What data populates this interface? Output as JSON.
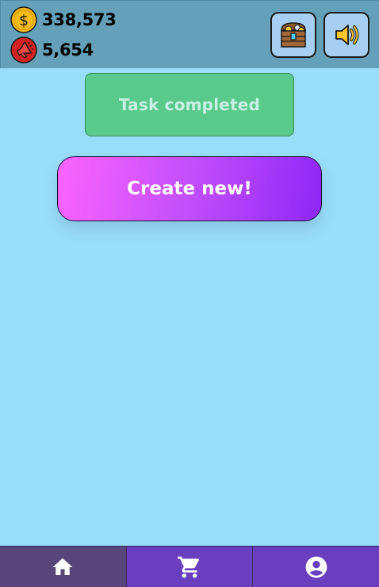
{
  "header": {
    "coins": {
      "value": "338,573",
      "icon": "dollar-coin-icon",
      "color": "#f5bc19"
    },
    "tickets": {
      "value": "5,654",
      "icon": "megaphone-badge-icon",
      "color": "#d42222"
    },
    "buttons": [
      {
        "icon": "treasure-chest-icon"
      },
      {
        "icon": "speaker-icon"
      }
    ]
  },
  "main": {
    "task_status": "Task completed",
    "create_label": "Create new!"
  },
  "navbar": {
    "tabs": [
      {
        "icon": "home-icon",
        "active": true
      },
      {
        "icon": "shopping-cart-icon",
        "active": false
      },
      {
        "icon": "account-icon",
        "active": false
      }
    ]
  },
  "colors": {
    "background": "#99def9",
    "header": "#64a1b8",
    "success": "#5ac98c",
    "create_gradient_start": "#fb64fd",
    "create_gradient_end": "#8e27f6",
    "nav": "#6a3fbf",
    "nav_active": "#56467a"
  }
}
